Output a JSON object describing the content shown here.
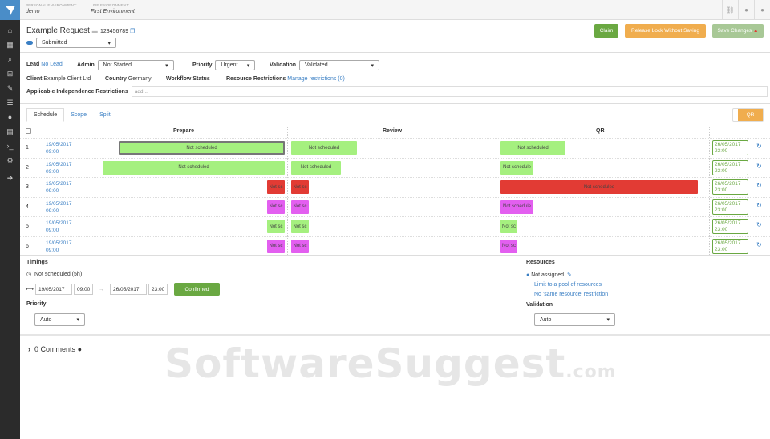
{
  "topbar": {
    "personal_caption": "PERSONAL ENVIRONMENT:",
    "personal_value": "demo",
    "live_caption": "LIVE ENVIRONMENT:",
    "live_value": "First Environment"
  },
  "header": {
    "title": "Example Request",
    "request_id": "123456789",
    "status": "Submitted",
    "claim_label": "Claim",
    "release_label": "Release Lock Without Saving",
    "save_label": "Save Changes"
  },
  "colors": {
    "claim": "#6aa842",
    "release": "#f0ad4e",
    "save": "#a8c896",
    "green_block": "#a5f07f",
    "red_block": "#e23b34",
    "magenta_block": "#e35ff0"
  },
  "fields": {
    "lead_label": "Lead",
    "lead_value": "No Lead",
    "admin_label": "Admin",
    "admin_value": "Not Started",
    "priority_label": "Priority",
    "priority_value": "Urgent",
    "validation_label": "Validation",
    "validation_value": "Validated",
    "client_label": "Client",
    "client_value": "Example Client Ltd",
    "country_label": "Country",
    "country_value": "Germany",
    "workflow_label": "Workflow Status",
    "restrictions_label": "Resource Restrictions",
    "restrictions_link": "Manage restrictions (0)",
    "independence_label": "Applicable Independence Restrictions",
    "independence_placeholder": "add..."
  },
  "tabs": [
    "Schedule",
    "Scope",
    "Split"
  ],
  "qr_button": "QR",
  "columns": [
    "Prepare",
    "Review",
    "QR"
  ],
  "rows": [
    {
      "n": "1",
      "start_date": "19/05/2017",
      "start_time": "09:00",
      "prepare": "Not scheduled",
      "review": "Not scheduled",
      "qr": "Not scheduled",
      "end_date": "26/05/2017",
      "end_time": "23:00"
    },
    {
      "n": "2",
      "start_date": "19/05/2017",
      "start_time": "09:00",
      "prepare": "Not scheduled",
      "review": "Not scheduled",
      "qr": "Not schedule",
      "end_date": "26/05/2017",
      "end_time": "23:00"
    },
    {
      "n": "3",
      "start_date": "19/05/2017",
      "start_time": "09:00",
      "prepare": "Not sc",
      "review": "Not sc",
      "qr": "Not scheduled",
      "end_date": "26/05/2017",
      "end_time": "23:00"
    },
    {
      "n": "4",
      "start_date": "19/05/2017",
      "start_time": "09:00",
      "prepare": "Not sc",
      "review": "Not sc",
      "qr": "Not schedule",
      "end_date": "26/05/2017",
      "end_time": "23:00"
    },
    {
      "n": "5",
      "start_date": "19/05/2017",
      "start_time": "09:00",
      "prepare": "Not sc",
      "review": "Not sc",
      "qr": "Not sc",
      "end_date": "26/05/2017",
      "end_time": "23:00"
    },
    {
      "n": "6",
      "start_date": "19/05/2017",
      "start_time": "09:00",
      "prepare": "Not sc",
      "review": "Not sc",
      "qr": "Not sc",
      "end_date": "26/05/2017",
      "end_time": "23:00"
    }
  ],
  "timings": {
    "label": "Timings",
    "status": "Not scheduled (5h)",
    "start_date": "19/05/2017",
    "start_time": "09:00",
    "end_date": "26/05/2017",
    "end_time": "23:00",
    "confirmed_label": "Confirmed"
  },
  "priority": {
    "label": "Priority",
    "value": "Auto"
  },
  "resources": {
    "label": "Resources",
    "assigned": "Not assigned",
    "limit_link": "Limit to a pool of resources",
    "same_link": "No 'same resource' restriction"
  },
  "validation": {
    "label": "Validation",
    "value": "Auto"
  },
  "comments": {
    "label": "0 Comments"
  },
  "watermark": {
    "main": "SoftwareSuggest",
    "suffix": ".com"
  }
}
